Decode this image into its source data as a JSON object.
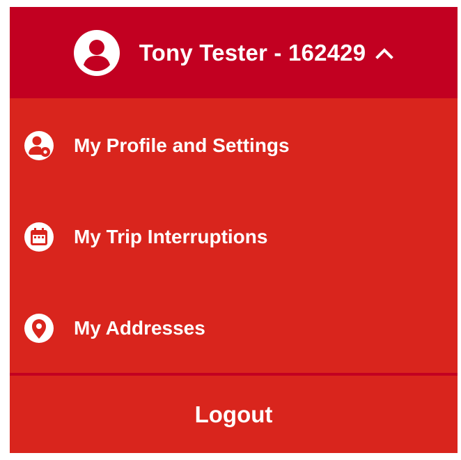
{
  "colors": {
    "header_bg": "#c20021",
    "menu_bg": "#d9251d",
    "divider": "#c20021",
    "text": "#ffffff"
  },
  "header": {
    "user_label": "Tony Tester - 162429",
    "avatar_icon": "user-circle-icon",
    "toggle_icon": "chevron-up-icon"
  },
  "menu": {
    "items": [
      {
        "label": "My Profile and Settings",
        "icon": "user-settings-icon"
      },
      {
        "label": "My Trip Interruptions",
        "icon": "calendar-icon"
      },
      {
        "label": "My Addresses",
        "icon": "map-pin-icon"
      }
    ]
  },
  "logout": {
    "label": "Logout"
  }
}
